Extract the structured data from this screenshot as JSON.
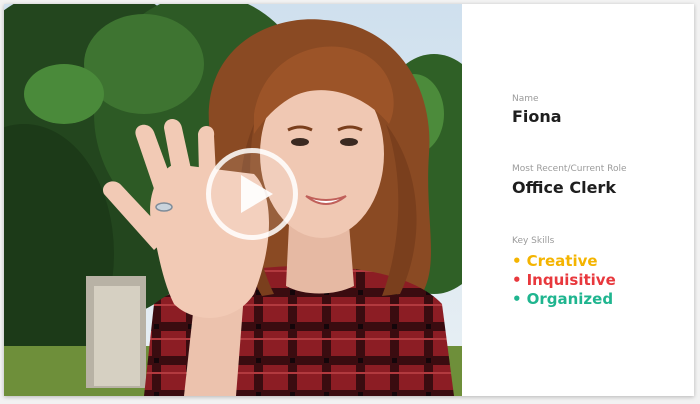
{
  "profile": {
    "name_label": "Name",
    "name": "Fiona",
    "role_label": "Most Recent/Current Role",
    "role": "Office Clerk",
    "skills_label": "Key Skills",
    "skills": [
      {
        "bullet": "•",
        "text": "Creative",
        "color": "#f4b400"
      },
      {
        "bullet": "•",
        "text": "Inquisitive",
        "color": "#e8383d"
      },
      {
        "bullet": "•",
        "text": "Organized",
        "color": "#1fb58f"
      }
    ]
  },
  "video": {
    "play_icon": "play-icon"
  }
}
